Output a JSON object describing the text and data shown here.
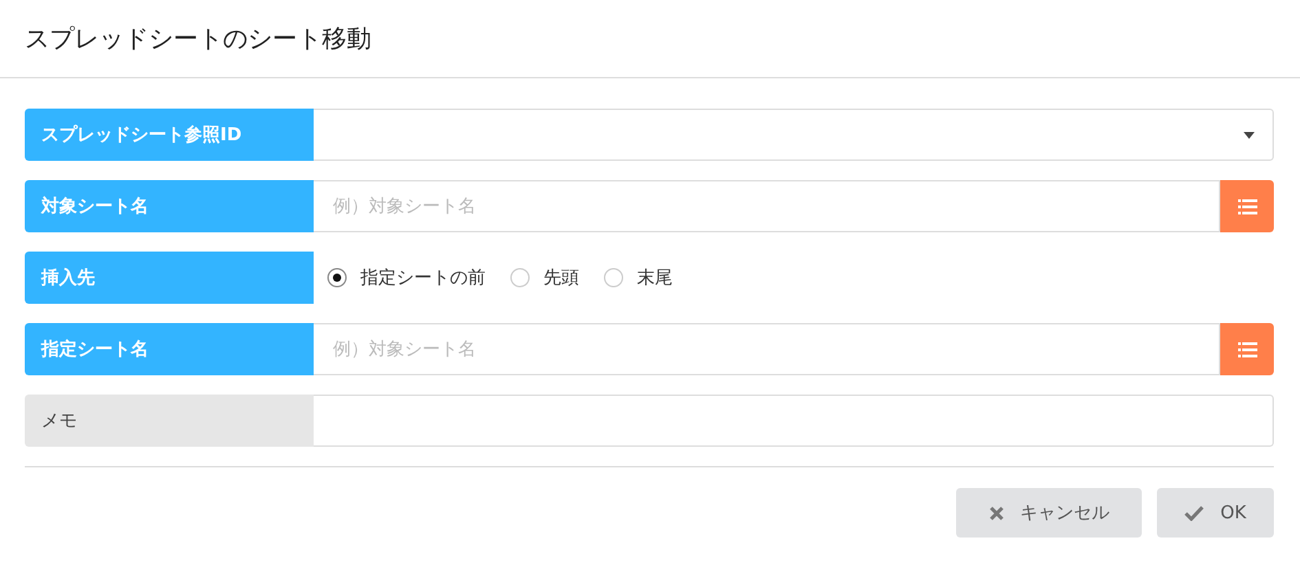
{
  "window": {
    "title": "スプレッドシートのシート移動"
  },
  "fields": [
    {
      "label": "スプレッドシート参照ID",
      "required": true,
      "kind": "select"
    },
    {
      "label": "対象シート名",
      "required": true,
      "kind": "picker",
      "placeholder": "例）対象シート名"
    },
    {
      "label": "挿入先",
      "required": true,
      "kind": "radio",
      "options": [
        {
          "label": "指定シートの前",
          "selected": true
        },
        {
          "label": "先頭",
          "selected": false
        },
        {
          "label": "末尾",
          "selected": false
        }
      ]
    },
    {
      "label": "指定シート名",
      "required": true,
      "kind": "picker",
      "placeholder": "例）対象シート名"
    },
    {
      "label": "メモ",
      "required": false,
      "kind": "text"
    }
  ],
  "buttons": [
    {
      "label": "キャンセル",
      "kind": "cancel"
    },
    {
      "label": "OK",
      "kind": "ok"
    }
  ]
}
